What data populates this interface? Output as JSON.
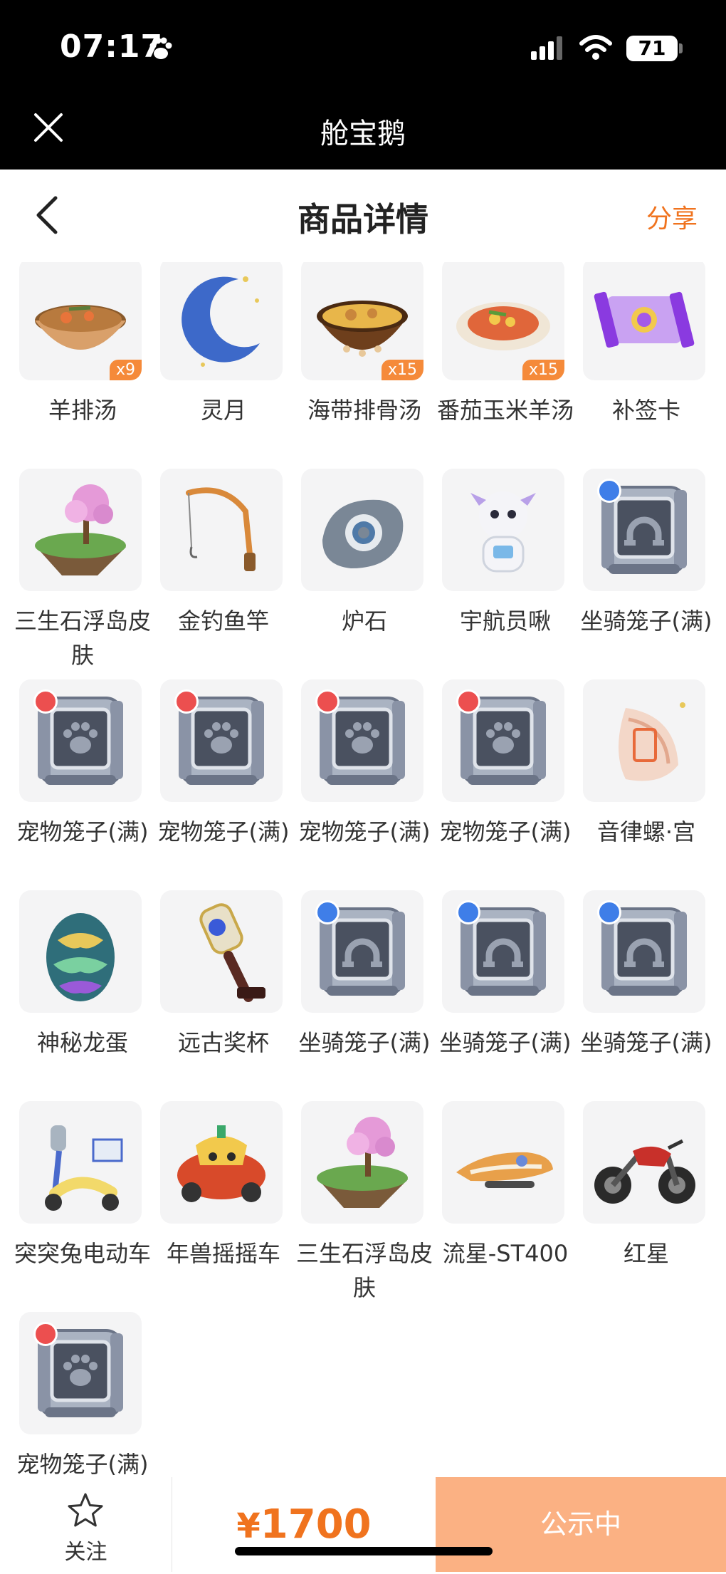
{
  "status_bar": {
    "time": "07:17",
    "battery": "71"
  },
  "app": {
    "title": "舱宝鹅"
  },
  "nav": {
    "title": "商品详情",
    "share": "分享"
  },
  "items": [
    {
      "label": "羊排汤",
      "qty": "x9",
      "icon": "soup-bowl-icon"
    },
    {
      "label": "灵月",
      "qty": "",
      "icon": "crescent-moon-icon"
    },
    {
      "label": "海带排骨汤",
      "qty": "x15",
      "icon": "stew-pot-icon"
    },
    {
      "label": "番茄玉米羊汤",
      "qty": "x15",
      "icon": "soup-plate-icon"
    },
    {
      "label": "补签卡",
      "qty": "",
      "icon": "ticket-card-icon"
    },
    {
      "label": "三生石浮岛皮肤",
      "qty": "",
      "icon": "floating-island-icon"
    },
    {
      "label": "金钓鱼竿",
      "qty": "",
      "icon": "fishing-rod-icon"
    },
    {
      "label": "炉石",
      "qty": "",
      "icon": "hearthstone-icon"
    },
    {
      "label": "宇航员啾",
      "qty": "",
      "icon": "astronaut-pet-icon"
    },
    {
      "label": "坐骑笼子(满)",
      "qty": "",
      "icon": "mount-cage-icon"
    },
    {
      "label": "宠物笼子(满)",
      "qty": "",
      "icon": "pet-cage-icon"
    },
    {
      "label": "宠物笼子(满)",
      "qty": "",
      "icon": "pet-cage-icon"
    },
    {
      "label": "宠物笼子(满)",
      "qty": "",
      "icon": "pet-cage-icon"
    },
    {
      "label": "宠物笼子(满)",
      "qty": "",
      "icon": "pet-cage-icon"
    },
    {
      "label": "音律螺·宫",
      "qty": "",
      "icon": "conch-shell-icon"
    },
    {
      "label": "神秘龙蛋",
      "qty": "",
      "icon": "dragon-egg-icon"
    },
    {
      "label": "远古奖杯",
      "qty": "",
      "icon": "trophy-icon"
    },
    {
      "label": "坐骑笼子(满)",
      "qty": "",
      "icon": "mount-cage-icon"
    },
    {
      "label": "坐骑笼子(满)",
      "qty": "",
      "icon": "mount-cage-icon"
    },
    {
      "label": "坐骑笼子(满)",
      "qty": "",
      "icon": "mount-cage-icon"
    },
    {
      "label": "突突兔电动车",
      "qty": "",
      "icon": "scooter-icon"
    },
    {
      "label": "年兽摇摇车",
      "qty": "",
      "icon": "beast-car-icon"
    },
    {
      "label": "三生石浮岛皮肤",
      "qty": "",
      "icon": "floating-island-icon"
    },
    {
      "label": "流星-ST400",
      "qty": "",
      "icon": "hoverbike-icon"
    },
    {
      "label": "红星",
      "qty": "",
      "icon": "motorcycle-icon"
    },
    {
      "label": "宠物笼子(满)",
      "qty": "",
      "icon": "pet-cage-icon"
    }
  ],
  "bottom": {
    "follow": "关注",
    "currency": "¥",
    "price": "1700",
    "status": "公示中"
  },
  "colors": {
    "accent": "#f0731e",
    "status_button": "#fbb183",
    "qty_badge": "#f58a3a"
  }
}
